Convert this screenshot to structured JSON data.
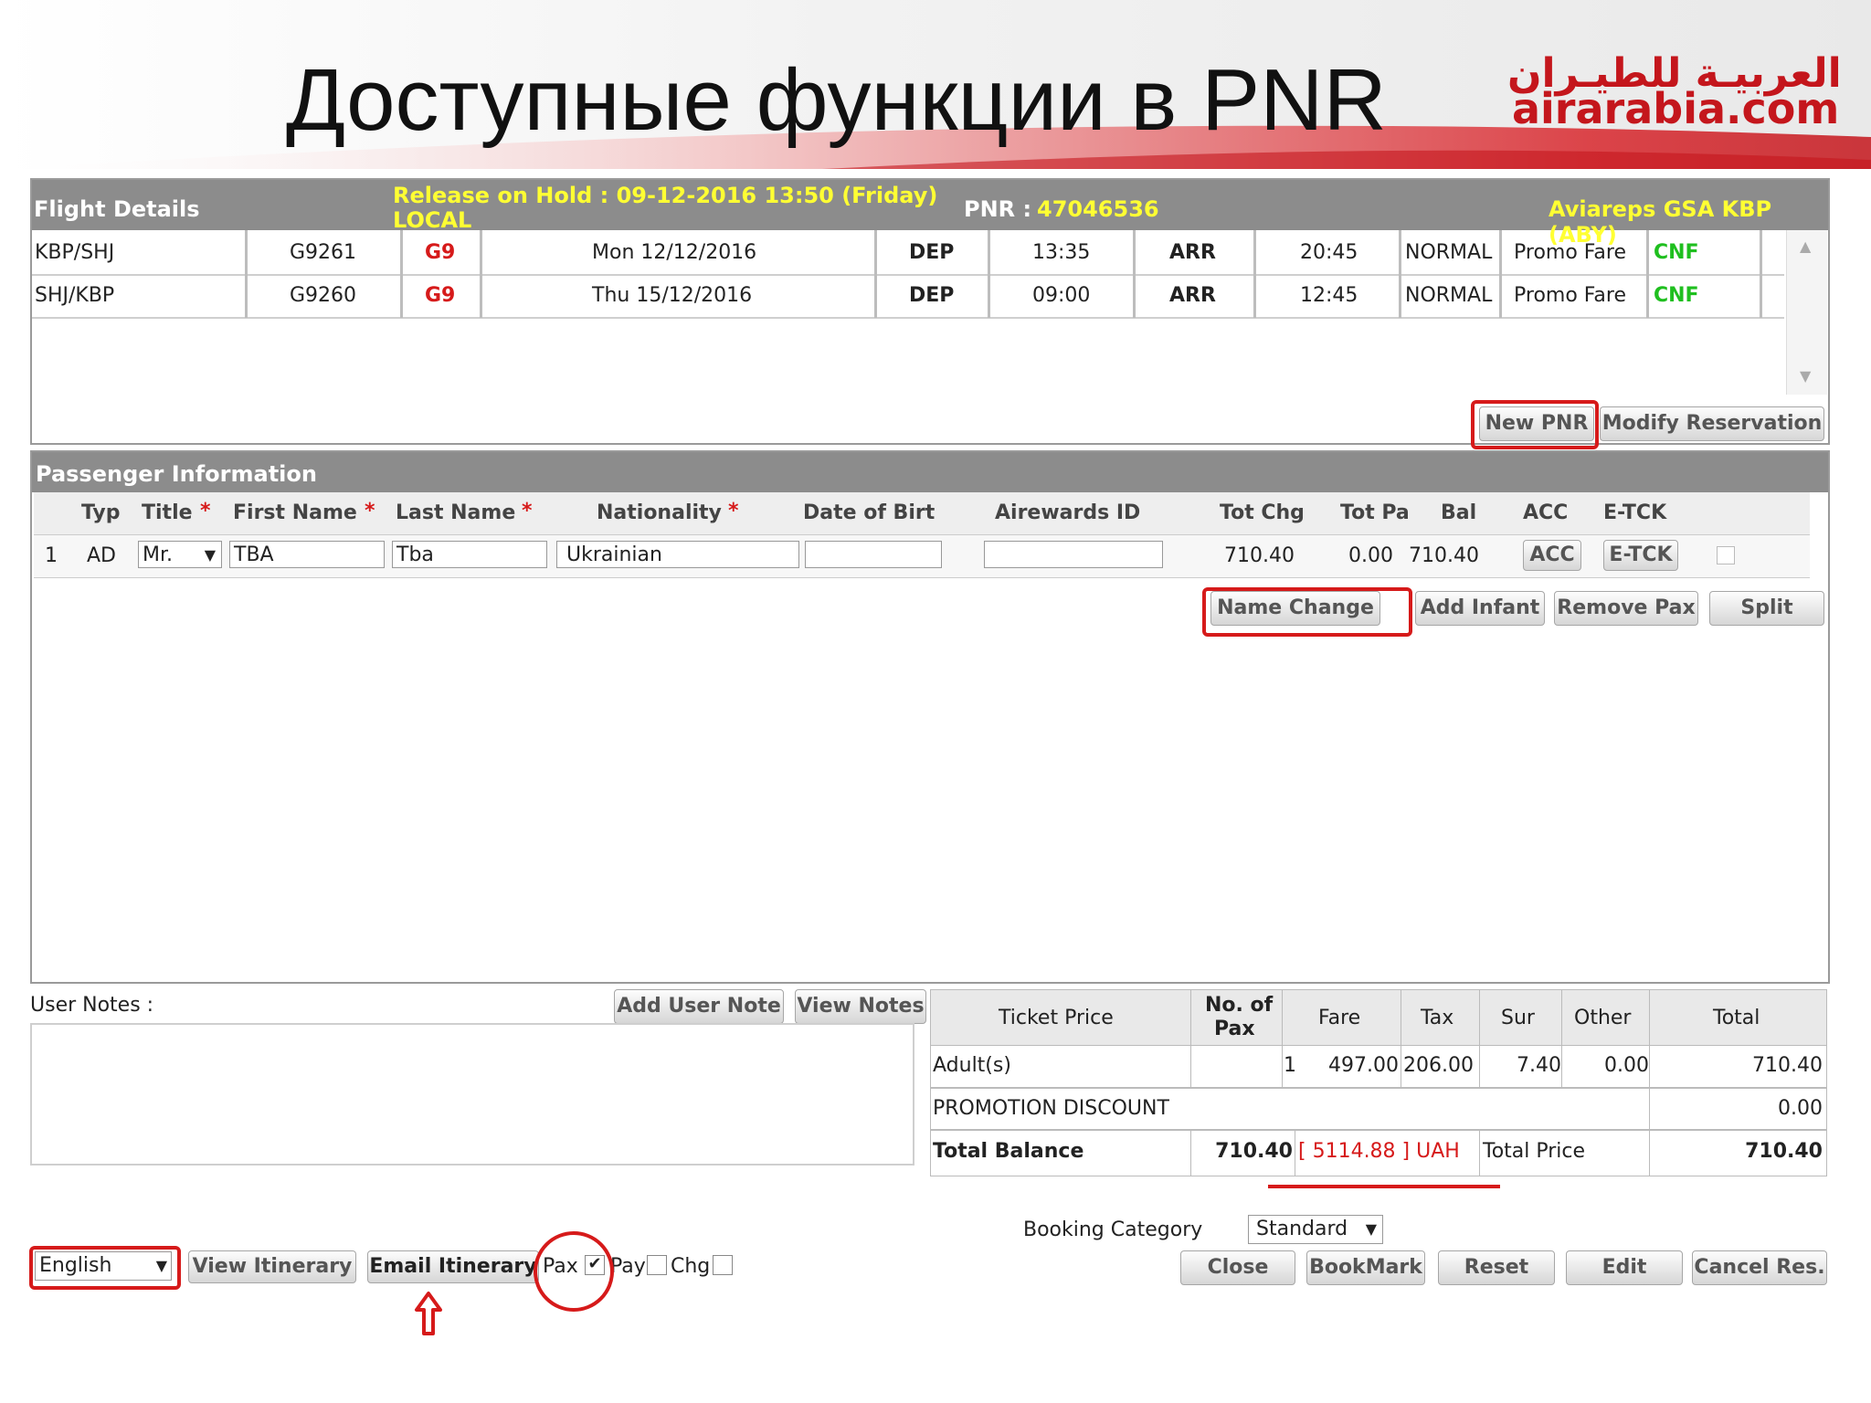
{
  "slide": {
    "title": "Доступные функции в PNR"
  },
  "logo": {
    "arabic": "العربيـة للطيـران",
    "english": "airarabia.com"
  },
  "flight_details": {
    "header": "Flight Details",
    "release_line1": "Release on Hold : 09-12-2016 13:50 (Friday)",
    "release_line2": "LOCAL",
    "pnr_label": "PNR :",
    "pnr_value": "47046536",
    "agent": "Aviareps GSA KBP (ABY)",
    "rows": [
      {
        "route": "KBP/SHJ",
        "flight": "G9261",
        "carrier": "G9",
        "date": "Mon 12/12/2016",
        "dep_label": "DEP",
        "dep_time": "13:35",
        "arr_label": "ARR",
        "arr_time": "20:45",
        "class": "NORMAL",
        "fare": "Promo Fare",
        "status": "CNF"
      },
      {
        "route": "SHJ/KBP",
        "flight": "G9260",
        "carrier": "G9",
        "date": "Thu 15/12/2016",
        "dep_label": "DEP",
        "dep_time": "09:00",
        "arr_label": "ARR",
        "arr_time": "12:45",
        "class": "NORMAL",
        "fare": "Promo Fare",
        "status": "CNF"
      }
    ],
    "buttons": {
      "new_pnr": "New PNR",
      "modify": "Modify Reservation"
    }
  },
  "passenger_info": {
    "header": "Passenger Information",
    "columns": {
      "typ": "Typ",
      "title": "Title",
      "first": "First Name",
      "last": "Last Name",
      "nationality": "Nationality",
      "dob": "Date of Birt",
      "airewards": "Airewards ID",
      "tot_chg": "Tot Chg",
      "tot_pay": "Tot Pa",
      "bal": "Bal",
      "acc": "ACC",
      "etck": "E-TCK"
    },
    "required_mark": "*",
    "row": {
      "index": "1",
      "typ": "AD",
      "title": "Mr.",
      "first": "TBA",
      "last": "Tba",
      "nationality": "Ukrainian",
      "dob": "",
      "airewards": "",
      "tot_chg": "710.40",
      "tot_pay": "0.00",
      "bal": "710.40",
      "acc": "ACC",
      "etck": "E-TCK"
    },
    "buttons": {
      "name_change": "Name Change",
      "add_infant": "Add Infant",
      "remove_pax": "Remove Pax",
      "split": "Split"
    }
  },
  "notes": {
    "label": "User Notes :",
    "add": "Add User Note",
    "view": "View Notes"
  },
  "price_table": {
    "headers": {
      "ticket_price": "Ticket Price",
      "no_pax_1": "No. of",
      "no_pax_2": "Pax",
      "fare": "Fare",
      "tax": "Tax",
      "sur": "Sur",
      "other": "Other",
      "total": "Total"
    },
    "adult": {
      "label": "Adult(s)",
      "pax": "1",
      "fare": "497.00",
      "tax": "206.00",
      "sur": "7.40",
      "other": "0.00",
      "total": "710.40"
    },
    "promo": {
      "label": "PROMOTION DISCOUNT",
      "value": "0.00"
    },
    "balance": {
      "label": "Total Balance",
      "value": "710.40",
      "uah": "[ 5114.88 ] UAH",
      "total_price_label": "Total Price",
      "total_price": "710.40"
    }
  },
  "footer": {
    "language": "English",
    "view_itinerary": "View Itinerary",
    "email_itinerary": "Email Itinerary",
    "pax": "Pax",
    "pay": "Pay",
    "chg": "Chg",
    "booking_category_label": "Booking Category",
    "booking_category_value": "Standard",
    "close": "Close",
    "bookmark": "BookMark",
    "reset": "Reset",
    "edit": "Edit",
    "cancel": "Cancel Res."
  }
}
